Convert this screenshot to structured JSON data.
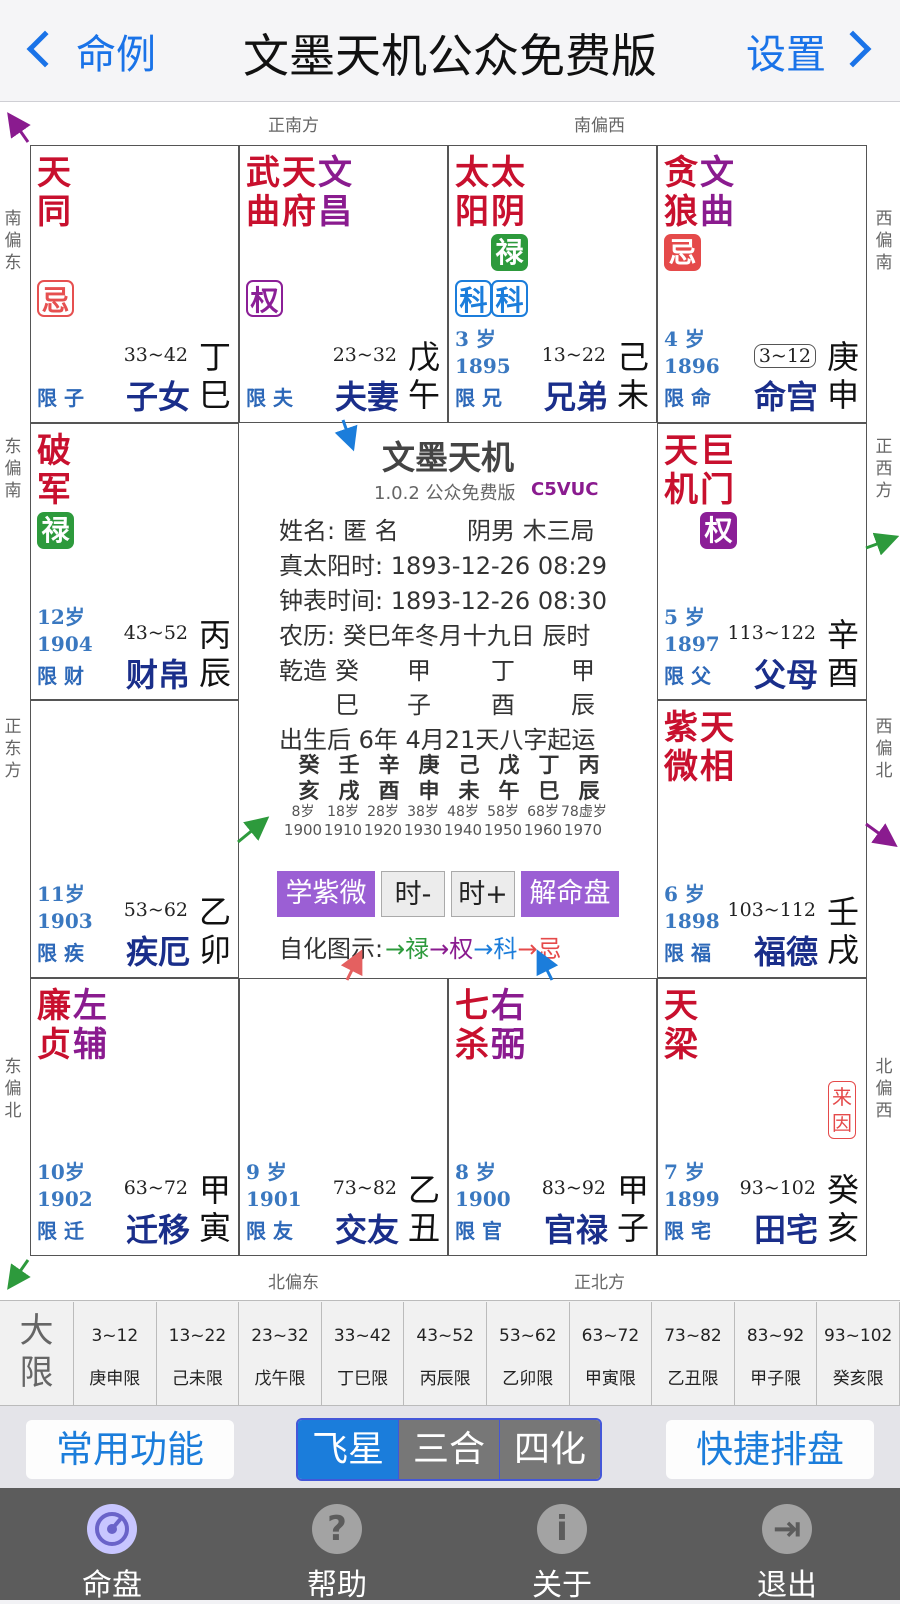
{
  "nav": {
    "back_label": "命例",
    "title": "文墨天机公众免费版",
    "settings_label": "设置"
  },
  "directions": {
    "s": "正南方",
    "ssw": "南偏西",
    "sse": "南偏东",
    "wsw": "西偏南",
    "ese": "东偏南",
    "w": "正西方",
    "e": "正东方",
    "wnw": "西偏北",
    "ene": "东偏北",
    "nnw": "北偏西",
    "nne": "北偏东",
    "n": "正北方"
  },
  "palaces": {
    "si": {
      "stars": [
        {
          "t": "天\n同",
          "cls": "major"
        }
      ],
      "badge": "忌",
      "age": "",
      "year": "",
      "limit": "限 子",
      "range": "33~42",
      "name": "子女",
      "gz": "丁\n巳"
    },
    "wu": {
      "stars": [
        {
          "t": "武\n曲",
          "cls": "major"
        },
        {
          "t": "天\n府",
          "cls": "major"
        },
        {
          "t": "文\n昌",
          "cls": "minor"
        }
      ],
      "badge": "权",
      "age": "",
      "year": "",
      "limit": "限 夫",
      "range": "23~32",
      "name": "夫妻",
      "gz": "戊\n午"
    },
    "wei": {
      "stars": [
        {
          "t": "太\n阳",
          "cls": "major"
        },
        {
          "t": "太\n阴",
          "cls": "major"
        }
      ],
      "badge_a": "禄",
      "badge_b": "科",
      "badge_c": "科",
      "age": "3 岁",
      "year": "1895",
      "limit": "限 兄",
      "range": "13~22",
      "name": "兄弟",
      "gz": "己\n未"
    },
    "shen": {
      "stars": [
        {
          "t": "贪\n狼",
          "cls": "major"
        },
        {
          "t": "文\n曲",
          "cls": "minor"
        }
      ],
      "badge": "忌",
      "age": "4 岁",
      "year": "1896",
      "limit": "限 命",
      "range": "3~12",
      "name": "命宫",
      "gz": "庚\n申"
    },
    "chen": {
      "stars": [
        {
          "t": "破\n军",
          "cls": "major"
        }
      ],
      "badge": "禄",
      "age": "12岁",
      "year": "1904",
      "limit": "限 财",
      "range": "43~52",
      "name": "财帛",
      "gz": "丙\n辰"
    },
    "you": {
      "stars": [
        {
          "t": "天\n机",
          "cls": "major"
        },
        {
          "t": "巨\n门",
          "cls": "major"
        }
      ],
      "badge": "权",
      "age": "5 岁",
      "year": "1897",
      "limit": "限 父",
      "range": "113~122",
      "name": "父母",
      "gz": "辛\n酉"
    },
    "mao": {
      "stars": [],
      "age": "11岁",
      "year": "1903",
      "limit": "限 疾",
      "range": "53~62",
      "name": "疾厄",
      "gz": "乙\n卯"
    },
    "xu": {
      "stars": [
        {
          "t": "紫\n微",
          "cls": "major"
        },
        {
          "t": "天\n相",
          "cls": "major"
        }
      ],
      "age": "6 岁",
      "year": "1898",
      "limit": "限 福",
      "range": "103~112",
      "name": "福德",
      "gz": "壬\n戌"
    },
    "yin": {
      "stars": [
        {
          "t": "廉\n贞",
          "cls": "major"
        },
        {
          "t": "左\n辅",
          "cls": "minor"
        }
      ],
      "age": "10岁",
      "year": "1902",
      "limit": "限 迁",
      "range": "63~72",
      "name": "迁移",
      "gz": "甲\n寅"
    },
    "chou": {
      "stars": [],
      "age": "9 岁",
      "year": "1901",
      "limit": "限 友",
      "range": "73~82",
      "name": "交友",
      "gz": "乙\n丑"
    },
    "zi": {
      "stars": [
        {
          "t": "七\n杀",
          "cls": "major"
        },
        {
          "t": "右\n弼",
          "cls": "minor"
        }
      ],
      "age": "8 岁",
      "year": "1900",
      "limit": "限 官",
      "range": "83~92",
      "name": "官禄",
      "gz": "甲\n子"
    },
    "hai": {
      "stars": [
        {
          "t": "天\n梁",
          "cls": "major"
        }
      ],
      "laiyin": "来\n因",
      "age": "7 岁",
      "year": "1899",
      "limit": "限 宅",
      "range": "93~102",
      "name": "田宅",
      "gz": "癸\n亥"
    }
  },
  "center": {
    "title": "文墨天机",
    "version": "1.0.2 公众免费版",
    "code": "C5VUC",
    "name_label": "姓名:",
    "name_value": "匿 名",
    "gender_ju": "阴男 木三局",
    "true_solar": "真太阳时: 1893-12-26   08:29",
    "clock_time": "钟表时间: 1893-12-26   08:30",
    "lunar": "农历: 癸巳年冬月十九日 辰时",
    "qianzao": "乾造",
    "stems": [
      "癸",
      "甲",
      "丁",
      "甲"
    ],
    "branches": [
      "巳",
      "子",
      "酉",
      "辰"
    ],
    "qiyun": "出生后 6年 4月21天八字起运",
    "dy_stems": [
      "癸",
      "壬",
      "辛",
      "庚",
      "己",
      "戊",
      "丁",
      "丙"
    ],
    "dy_branches": [
      "亥",
      "戌",
      "酉",
      "申",
      "未",
      "午",
      "巳",
      "辰"
    ],
    "dy_ages": [
      "8岁",
      "18岁",
      "28岁",
      "38岁",
      "48岁",
      "58岁",
      "68岁",
      "78虚岁"
    ],
    "dy_years": [
      "1900",
      "1910",
      "1920",
      "1930",
      "1940",
      "1950",
      "1960",
      "1970"
    ],
    "btn_learn": "学紫微",
    "btn_minus": "时-",
    "btn_plus": "时+",
    "btn_explain": "解命盘",
    "legend_label": "自化图示:",
    "legend_lu": "禄",
    "legend_quan": "权",
    "legend_ke": "科",
    "legend_ji": "忌"
  },
  "daxian": {
    "label": "大\n限",
    "ranges": [
      "3~12",
      "13~22",
      "23~32",
      "33~42",
      "43~52",
      "53~62",
      "63~72",
      "73~82",
      "83~92",
      "93~102"
    ],
    "gz": [
      "庚申限",
      "己未限",
      "戊午限",
      "丁巳限",
      "丙辰限",
      "乙卯限",
      "甲寅限",
      "乙丑限",
      "甲子限",
      "癸亥限"
    ]
  },
  "actions": {
    "common": "常用功能",
    "feixing": "飞星",
    "sanhe": "三合",
    "sihua": "四化",
    "quick": "快捷排盘"
  },
  "tabs": {
    "chart": "命盘",
    "help": "帮助",
    "about": "关于",
    "exit": "退出"
  },
  "colors": {
    "accent": "#1b7ddb",
    "star_red": "#c8102e",
    "star_purple": "#8a1b8f",
    "palace_blue": "#1a2e8a"
  }
}
